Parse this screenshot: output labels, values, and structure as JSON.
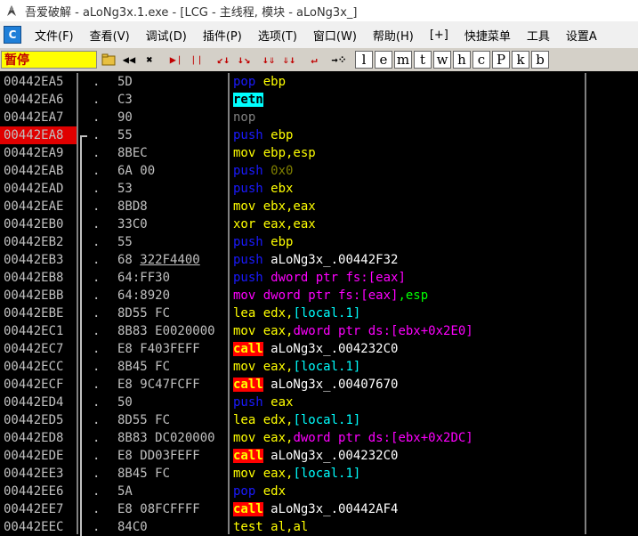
{
  "title": "吾爱破解 - aLoNg3x.1.exe - [LCG - 主线程, 模块 - aLoNg3x_]",
  "menu": [
    "文件(F)",
    "查看(V)",
    "调试(D)",
    "插件(P)",
    "选项(T)",
    "窗口(W)",
    "帮助(H)",
    "[+]",
    "快捷菜单",
    "工具",
    "设置A"
  ],
  "app_icon_letter": "C",
  "status": "暂停",
  "toolbar_letters": [
    "l",
    "e",
    "m",
    "t",
    "w",
    "h",
    "c",
    "P",
    "k",
    "b"
  ],
  "rows": [
    {
      "addr": "00442EA5",
      "hex": "5D",
      "asm": [
        {
          "t": "pop ",
          "c": "c-blue"
        },
        {
          "t": "ebp",
          "c": "c-yellow"
        }
      ]
    },
    {
      "addr": "00442EA6",
      "hex": "C3",
      "asm": [
        {
          "t": "retn",
          "c": "retn-box"
        }
      ]
    },
    {
      "addr": "00442EA7",
      "hex": "90",
      "asm": [
        {
          "t": "nop",
          "c": "c-gray"
        }
      ]
    },
    {
      "addr": "00442EA8",
      "hex": "55",
      "hl": true,
      "bracket": "top",
      "asm": [
        {
          "t": "push ",
          "c": "c-blue"
        },
        {
          "t": "ebp",
          "c": "c-yellow"
        }
      ]
    },
    {
      "addr": "00442EA9",
      "hex": "8BEC",
      "asm": [
        {
          "t": "mov ",
          "c": "c-yellow"
        },
        {
          "t": "ebp,esp",
          "c": "c-yellow"
        }
      ]
    },
    {
      "addr": "00442EAB",
      "hex": "6A 00",
      "asm": [
        {
          "t": "push ",
          "c": "c-blue"
        },
        {
          "t": "0x0",
          "c": "c-num"
        }
      ]
    },
    {
      "addr": "00442EAD",
      "hex": "53",
      "asm": [
        {
          "t": "push ",
          "c": "c-blue"
        },
        {
          "t": "ebx",
          "c": "c-yellow"
        }
      ]
    },
    {
      "addr": "00442EAE",
      "hex": "8BD8",
      "asm": [
        {
          "t": "mov ",
          "c": "c-yellow"
        },
        {
          "t": "ebx,eax",
          "c": "c-yellow"
        }
      ]
    },
    {
      "addr": "00442EB0",
      "hex": "33C0",
      "asm": [
        {
          "t": "xor ",
          "c": "c-yellow"
        },
        {
          "t": "eax,eax",
          "c": "c-yellow"
        }
      ]
    },
    {
      "addr": "00442EB2",
      "hex": "55",
      "asm": [
        {
          "t": "push ",
          "c": "c-blue"
        },
        {
          "t": "ebp",
          "c": "c-yellow"
        }
      ]
    },
    {
      "addr": "00442EB3",
      "hex": "68 ",
      "hexu": "322F4400",
      "asm": [
        {
          "t": "push ",
          "c": "c-blue"
        },
        {
          "t": "aLoNg3x_.00442F32",
          "c": "c-white"
        }
      ]
    },
    {
      "addr": "00442EB8",
      "hex": "64:FF30",
      "asm": [
        {
          "t": "push ",
          "c": "c-blue"
        },
        {
          "t": "dword ptr fs:[eax]",
          "c": "c-magenta"
        }
      ]
    },
    {
      "addr": "00442EBB",
      "hex": "64:8920",
      "asm": [
        {
          "t": "mov ",
          "c": "c-magenta"
        },
        {
          "t": "dword ptr fs:[eax]",
          "c": "c-magenta"
        },
        {
          "t": ",esp",
          "c": "c-green"
        }
      ]
    },
    {
      "addr": "00442EBE",
      "hex": "8D55 FC",
      "asm": [
        {
          "t": "lea ",
          "c": "c-yellow"
        },
        {
          "t": "edx,",
          "c": "c-yellow"
        },
        {
          "t": "[local.1]",
          "c": "c-cyan"
        }
      ]
    },
    {
      "addr": "00442EC1",
      "hex": "8B83 E0020000",
      "asm": [
        {
          "t": "mov ",
          "c": "c-yellow"
        },
        {
          "t": "eax,",
          "c": "c-yellow"
        },
        {
          "t": "dword ptr ds:[ebx+0x2E0]",
          "c": "c-magenta"
        }
      ]
    },
    {
      "addr": "00442EC7",
      "hex": "E8 F403FEFF",
      "asm": [
        {
          "t": "call",
          "c": "call-box"
        },
        {
          "t": " aLoNg3x_.004232C0",
          "c": "c-white"
        }
      ]
    },
    {
      "addr": "00442ECC",
      "hex": "8B45 FC",
      "asm": [
        {
          "t": "mov ",
          "c": "c-yellow"
        },
        {
          "t": "eax,",
          "c": "c-yellow"
        },
        {
          "t": "[local.1]",
          "c": "c-cyan"
        }
      ]
    },
    {
      "addr": "00442ECF",
      "hex": "E8 9C47FCFF",
      "asm": [
        {
          "t": "call",
          "c": "call-box"
        },
        {
          "t": " aLoNg3x_.00407670",
          "c": "c-white"
        }
      ]
    },
    {
      "addr": "00442ED4",
      "hex": "50",
      "asm": [
        {
          "t": "push ",
          "c": "c-blue"
        },
        {
          "t": "eax",
          "c": "c-yellow"
        }
      ]
    },
    {
      "addr": "00442ED5",
      "hex": "8D55 FC",
      "asm": [
        {
          "t": "lea ",
          "c": "c-yellow"
        },
        {
          "t": "edx,",
          "c": "c-yellow"
        },
        {
          "t": "[local.1]",
          "c": "c-cyan"
        }
      ]
    },
    {
      "addr": "00442ED8",
      "hex": "8B83 DC020000",
      "asm": [
        {
          "t": "mov ",
          "c": "c-yellow"
        },
        {
          "t": "eax,",
          "c": "c-yellow"
        },
        {
          "t": "dword ptr ds:[ebx+0x2DC]",
          "c": "c-magenta"
        }
      ]
    },
    {
      "addr": "00442EDE",
      "hex": "E8 DD03FEFF",
      "asm": [
        {
          "t": "call",
          "c": "call-box"
        },
        {
          "t": " aLoNg3x_.004232C0",
          "c": "c-white"
        }
      ]
    },
    {
      "addr": "00442EE3",
      "hex": "8B45 FC",
      "asm": [
        {
          "t": "mov ",
          "c": "c-yellow"
        },
        {
          "t": "eax,",
          "c": "c-yellow"
        },
        {
          "t": "[local.1]",
          "c": "c-cyan"
        }
      ]
    },
    {
      "addr": "00442EE6",
      "hex": "5A",
      "asm": [
        {
          "t": "pop ",
          "c": "c-blue"
        },
        {
          "t": "edx",
          "c": "c-yellow"
        }
      ]
    },
    {
      "addr": "00442EE7",
      "hex": "E8 08FCFFFF",
      "asm": [
        {
          "t": "call",
          "c": "call-box"
        },
        {
          "t": " aLoNg3x_.00442AF4",
          "c": "c-white"
        }
      ]
    },
    {
      "addr": "00442EEC",
      "hex": "84C0",
      "asm": [
        {
          "t": "test ",
          "c": "c-yellow"
        },
        {
          "t": "al,al",
          "c": "c-yellow"
        }
      ]
    }
  ]
}
